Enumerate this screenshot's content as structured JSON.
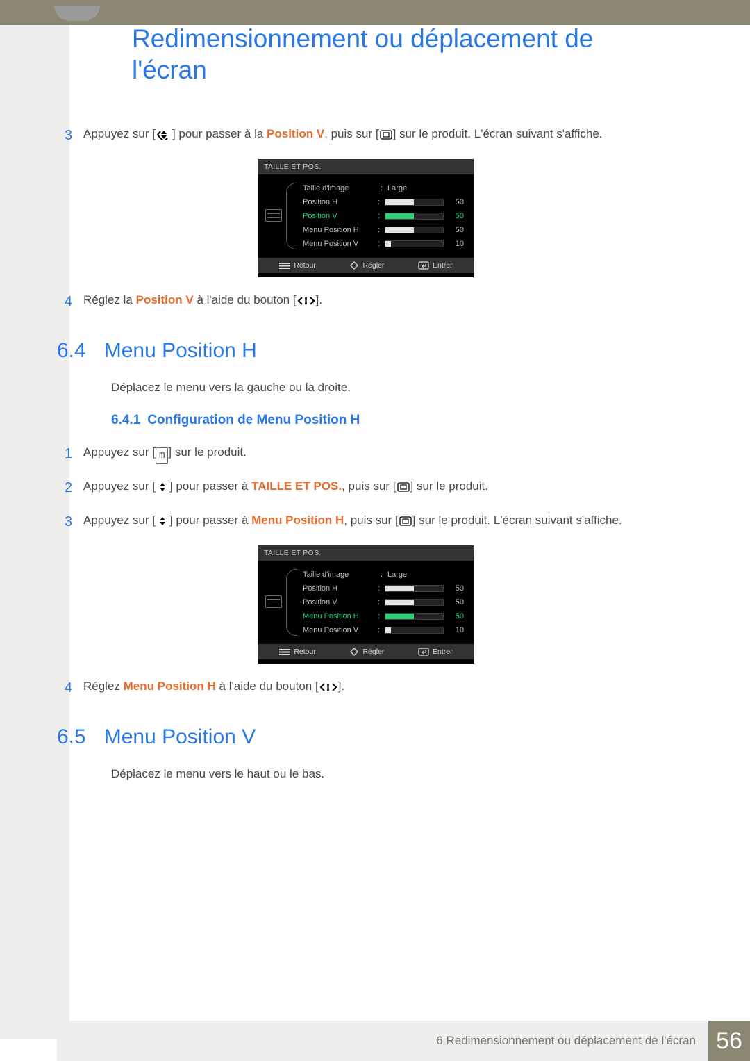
{
  "page": {
    "title": "Redimensionnement ou déplacement de l'écran",
    "footer_text": "6 Redimensionnement ou déplacement de l'écran",
    "page_number": "56"
  },
  "icons": {
    "updown": "up-down-icon",
    "enter": "enter-icon",
    "leftright": "left-right-icon",
    "menu_key": "m"
  },
  "stepsA": {
    "s3": {
      "num": "3",
      "t1": "Appuyez sur [",
      "t2": "] pour passer à la ",
      "hl": "Position V",
      "t3": ", puis sur [",
      "t4": "] sur le produit. L'écran suivant s'affiche."
    },
    "s4": {
      "num": "4",
      "t1": "Réglez la ",
      "hl": "Position V",
      "t2": " à l'aide du bouton [",
      "t3": "]."
    }
  },
  "osd1": {
    "title": "TAILLE ET POS.",
    "rows": [
      {
        "label": "Taille d'image",
        "value": "Large",
        "slider": null,
        "num": "",
        "selected": false
      },
      {
        "label": "Position H",
        "value": "",
        "slider": 50,
        "num": "50",
        "selected": false
      },
      {
        "label": "Position V",
        "value": "",
        "slider": 50,
        "num": "50",
        "selected": true
      },
      {
        "label": "Menu Position H",
        "value": "",
        "slider": 50,
        "num": "50",
        "selected": false
      },
      {
        "label": "Menu Position V",
        "value": "",
        "slider": 10,
        "num": "10",
        "selected": false
      }
    ],
    "footer": {
      "back": "Retour",
      "adjust": "Régler",
      "enter": "Entrer"
    }
  },
  "section64": {
    "num": "6.4",
    "title": "Menu Position H",
    "desc": "Déplacez le menu vers la gauche ou la droite.",
    "sub_num": "6.4.1",
    "sub_title": "Configuration de Menu Position H",
    "steps": {
      "s1": {
        "num": "1",
        "t1": "Appuyez sur [",
        "key": "m",
        "t2": "] sur le produit."
      },
      "s2": {
        "num": "2",
        "t1": "Appuyez sur [",
        "t2": "] pour passer à ",
        "hl": "TAILLE ET POS.",
        "t3": ", puis sur [",
        "t4": "] sur le produit."
      },
      "s3": {
        "num": "3",
        "t1": "Appuyez sur [",
        "t2": "] pour passer à ",
        "hl": "Menu Position H",
        "t3": ", puis sur [",
        "t4": "] sur le produit. L'écran suivant s'affiche."
      },
      "s4": {
        "num": "4",
        "t1": "Réglez ",
        "hl": "Menu Position H",
        "t2": " à l'aide du bouton [",
        "t3": "]."
      }
    }
  },
  "osd2": {
    "title": "TAILLE ET POS.",
    "rows": [
      {
        "label": "Taille d'image",
        "value": "Large",
        "slider": null,
        "num": "",
        "selected": false
      },
      {
        "label": "Position H",
        "value": "",
        "slider": 50,
        "num": "50",
        "selected": false
      },
      {
        "label": "Position V",
        "value": "",
        "slider": 50,
        "num": "50",
        "selected": false
      },
      {
        "label": "Menu Position H",
        "value": "",
        "slider": 50,
        "num": "50",
        "selected": true
      },
      {
        "label": "Menu Position V",
        "value": "",
        "slider": 10,
        "num": "10",
        "selected": false
      }
    ],
    "footer": {
      "back": "Retour",
      "adjust": "Régler",
      "enter": "Entrer"
    }
  },
  "section65": {
    "num": "6.5",
    "title": "Menu Position V",
    "desc": "Déplacez le menu vers le haut ou le bas."
  }
}
